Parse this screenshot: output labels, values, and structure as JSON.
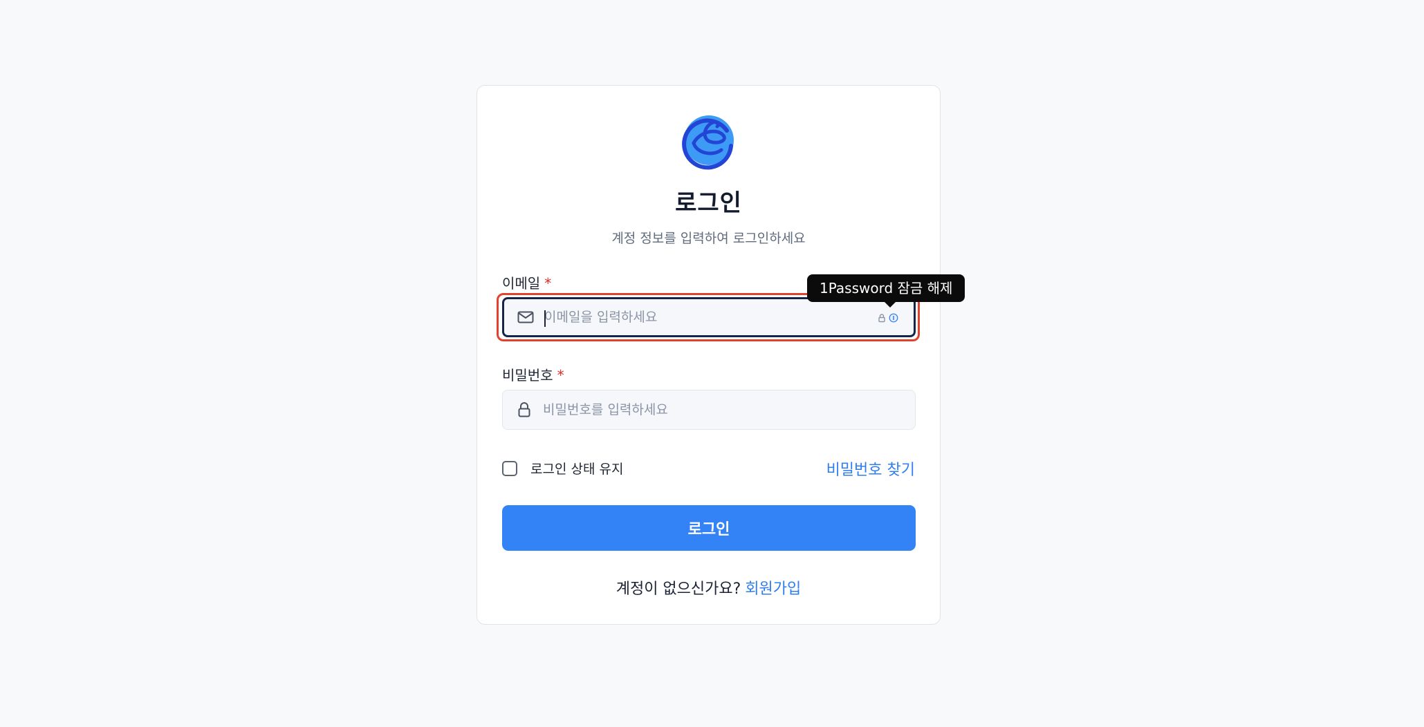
{
  "app": {
    "title": "로그인",
    "subtitle": "계정 정보를 입력하여 로그인하세요"
  },
  "form": {
    "email": {
      "label": "이메일",
      "required_mark": "*",
      "placeholder": "이메일을 입력하세요",
      "value": ""
    },
    "password": {
      "label": "비밀번호",
      "required_mark": "*",
      "placeholder": "비밀번호를 입력하세요",
      "value": ""
    },
    "remember_label": "로그인 상태 유지",
    "remember_checked": false,
    "find_password_label": "비밀번호 찾기",
    "submit_label": "로그인"
  },
  "signup": {
    "prompt": "계정이 없으신가요?",
    "link_label": "회원가입"
  },
  "password_manager": {
    "tooltip": "1Password 잠금 해제"
  },
  "icons": {
    "logo": "brand-logo",
    "email": "mail-icon",
    "password": "lock-icon",
    "pm_lock": "lock-icon",
    "pm_info": "info-icon"
  },
  "colors": {
    "accent": "#3383f7",
    "link": "#2f7ef0",
    "required": "#e02b2b",
    "focus_highlight": "#e2412e",
    "field_focus_border": "#16244a",
    "background": "#f8f9fb"
  }
}
